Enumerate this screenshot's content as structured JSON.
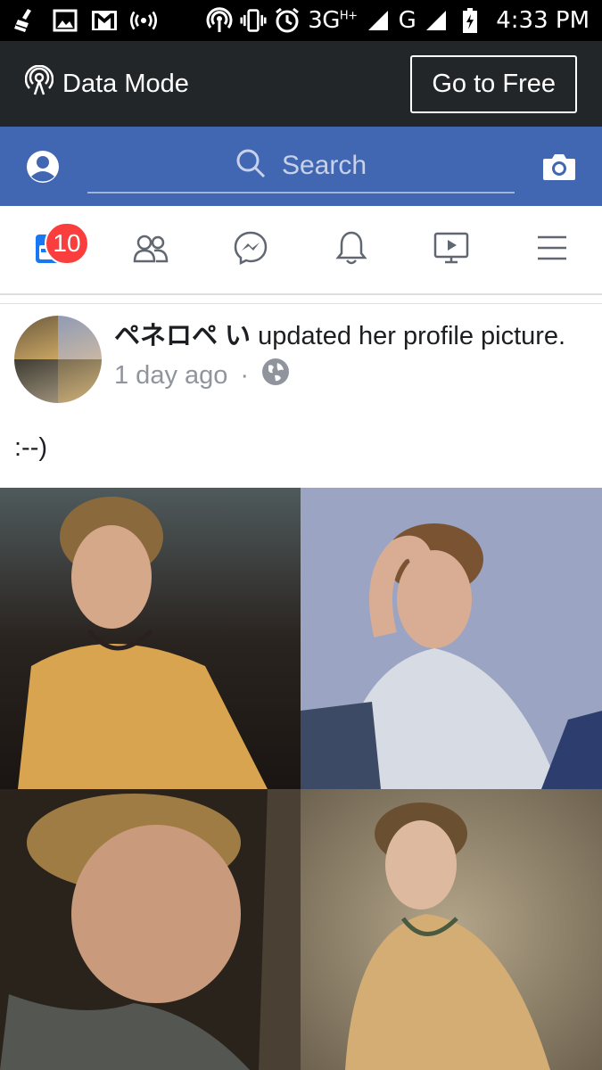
{
  "status_bar": {
    "network": "3G",
    "network_sup": "H+",
    "network2": "G",
    "time": "4:33 PM"
  },
  "data_bar": {
    "mode_label": "Data Mode",
    "go_free_label": "Go to Free"
  },
  "header": {
    "search_placeholder": "Search",
    "brand_color": "#4267b2"
  },
  "nav": {
    "notification_badge": "10",
    "items": [
      "news-feed-icon",
      "friends-icon",
      "messenger-icon",
      "notifications-bell-icon",
      "watch-video-icon",
      "menu-icon"
    ]
  },
  "post": {
    "author": "ペネロペ い",
    "action": " updated her profile picture.",
    "time": "1 day ago",
    "separator": "·",
    "privacy": "globe-icon",
    "text": ":--)"
  }
}
